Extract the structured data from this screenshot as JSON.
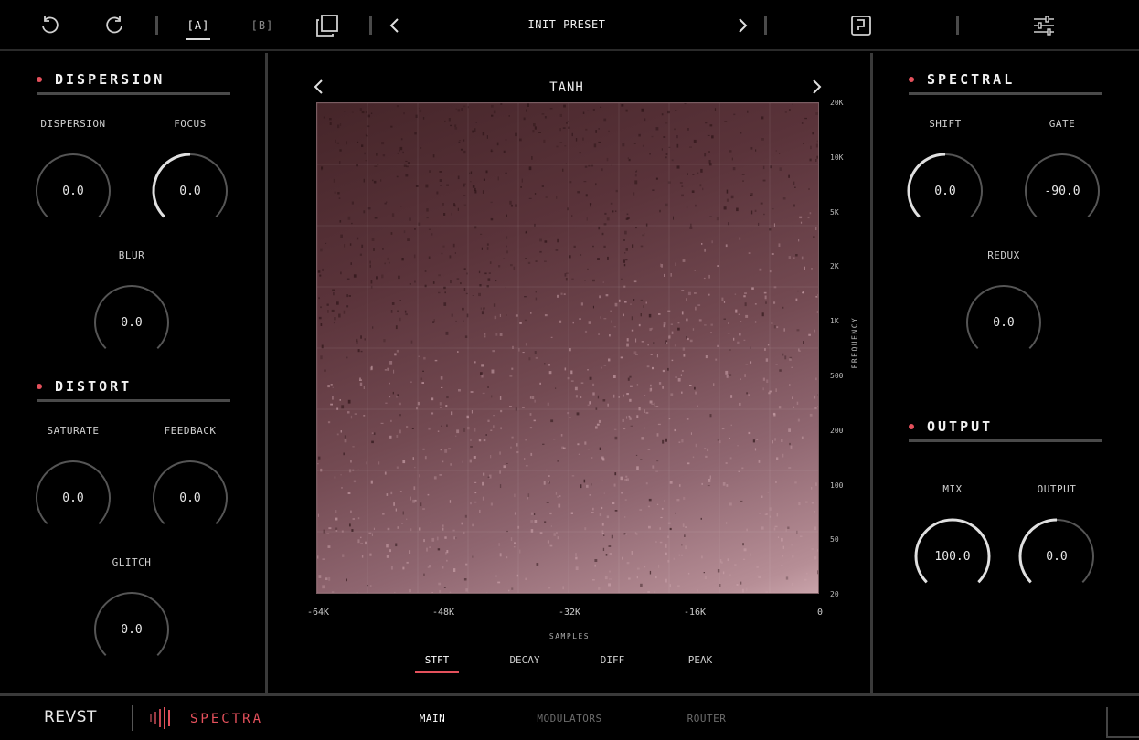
{
  "colors": {
    "accent": "#e5515c",
    "panel_border": "#3a3a3a",
    "knob_track": "#555555",
    "knob_active": "#e0e0e0"
  },
  "topbar": {
    "undo_icon": "undo-icon",
    "redo_icon": "redo-icon",
    "slot_a": "[A]",
    "slot_b": "[B]",
    "copy_icon": "copy-icon",
    "preset_prev_icon": "chevron-left-icon",
    "preset_name": "INIT PRESET",
    "preset_next_icon": "chevron-right-icon",
    "save_icon": "save-icon",
    "menu_icon": "settings-sliders-icon"
  },
  "dispersion": {
    "title": "DISPERSION",
    "knobs": [
      {
        "label": "DISPERSION",
        "value": "0.0",
        "level": 0
      },
      {
        "label": "FOCUS",
        "value": "0.0",
        "level": 0.5
      },
      {
        "label": "BLUR",
        "value": "0.0",
        "level": 0
      }
    ]
  },
  "distort": {
    "title": "DISTORT",
    "knobs": [
      {
        "label": "SATURATE",
        "value": "0.0",
        "level": 0
      },
      {
        "label": "FEEDBACK",
        "value": "0.0",
        "level": 0
      },
      {
        "label": "GLITCH",
        "value": "0.0",
        "level": 0
      }
    ]
  },
  "spectral": {
    "title": "SPECTRAL",
    "knobs": [
      {
        "label": "SHIFT",
        "value": "0.0",
        "level": 0.5
      },
      {
        "label": "GATE",
        "value": "-90.0",
        "level": 0
      },
      {
        "label": "REDUX",
        "value": "0.0",
        "level": 0
      }
    ]
  },
  "output": {
    "title": "OUTPUT",
    "knobs": [
      {
        "label": "MIX",
        "value": "100.0",
        "level": 1
      },
      {
        "label": "OUTPUT",
        "value": "0.0",
        "level": 0.5
      }
    ]
  },
  "spectrogram": {
    "curve_name": "TANH",
    "freq_labels": [
      "20K",
      "10K",
      "5K",
      "2K",
      "1K",
      "500",
      "200",
      "100",
      "50",
      "20"
    ],
    "freq_axis_title": "FREQUENCY",
    "x_labels": [
      "-64K",
      "-48K",
      "-32K",
      "-16K",
      "0"
    ],
    "x_axis_title": "SAMPLES",
    "view_tabs": [
      "STFT",
      "DECAY",
      "DIFF",
      "PEAK"
    ],
    "active_view": "STFT"
  },
  "bottombar": {
    "brand": "REVST",
    "product": "SPECTRA",
    "product_icon": "spectra-bars-icon",
    "tabs": [
      "MAIN",
      "MODULATORS",
      "ROUTER"
    ],
    "active_tab": "MAIN"
  }
}
